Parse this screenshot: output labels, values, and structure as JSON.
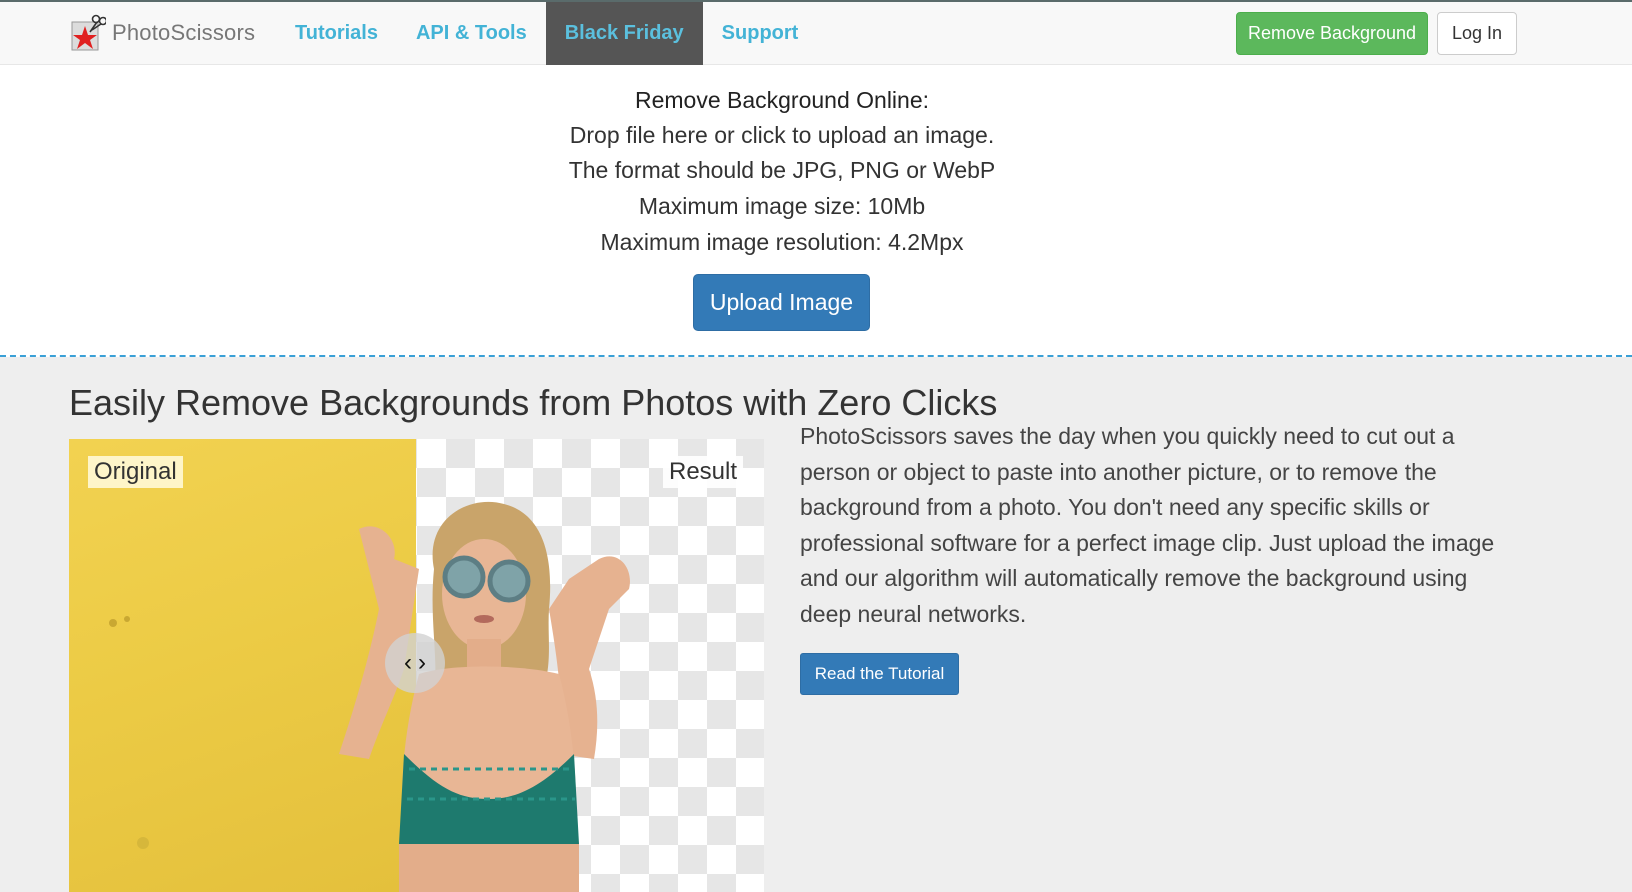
{
  "navbar": {
    "brand": "PhotoScissors",
    "links": [
      "Tutorials",
      "API & Tools",
      "Black Friday",
      "Support"
    ],
    "active_link": "Black Friday",
    "remove_background_label": "Remove Background",
    "login_label": "Log In"
  },
  "upload": {
    "title": "Remove Background Online:",
    "lines": [
      "Drop file here or click to upload an image.",
      "The format should be JPG, PNG or WebP",
      "Maximum image size: 10Mb",
      "Maximum image resolution: 4.2Mpx"
    ],
    "button_label": "Upload Image"
  },
  "feature": {
    "title": "Easily Remove Backgrounds from Photos with Zero Clicks",
    "original_label": "Original",
    "result_label": "Result",
    "description": "PhotoScissors saves the day when you quickly need to cut out a person or object to paste into another picture, or to remove the background from a photo. You don't need any specific skills or professional software for a perfect image clip. Just upload the image and our algorithm will automatically remove the background using deep neural networks.",
    "tutorial_button_label": "Read the Tutorial",
    "slider_left_glyph": "‹",
    "slider_right_glyph": "›"
  },
  "colors": {
    "nav_link": "#43b3d6",
    "nav_active_bg": "#555555",
    "remove_bg_button": "#5cb85c",
    "primary_button": "#337ab7",
    "dashed_border": "#3aa0d6",
    "original_bg": "#f2d251"
  }
}
